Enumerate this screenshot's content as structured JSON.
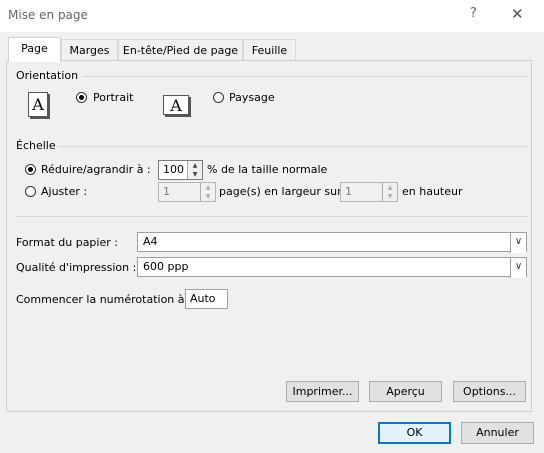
{
  "window": {
    "title": "Mise en page",
    "help_glyph": "?",
    "close_glyph": "✕"
  },
  "tabs": [
    "Page",
    "Marges",
    "En-tête/Pied de page",
    "Feuille"
  ],
  "orientation": {
    "heading": "Orientation",
    "portrait_label": "Portrait",
    "landscape_label": "Paysage",
    "icon_letter": "A",
    "selected": "portrait"
  },
  "scale": {
    "heading": "Échelle",
    "reduce_label": "Réduire/agrandir à :",
    "reduce_value": "100",
    "reduce_suffix": "% de la taille normale",
    "fit_label": "Ajuster :",
    "fit_wide_value": "1",
    "fit_wide_suffix": "page(s) en largeur sur",
    "fit_tall_value": "1",
    "fit_tall_suffix": "en hauteur",
    "selected": "reduce"
  },
  "paper": {
    "size_label": "Format du papier :",
    "size_value": "A4",
    "quality_label": "Qualité d'impression :",
    "quality_value": "600 ppp",
    "first_page_label": "Commencer la numérotation à :",
    "first_page_value": "Auto"
  },
  "buttons": {
    "print": "Imprimer...",
    "preview": "Aperçu",
    "options": "Options...",
    "ok": "OK",
    "cancel": "Annuler"
  },
  "icons": {
    "up_arrow": "▲",
    "down_arrow": "▼",
    "chevron": "∨"
  }
}
